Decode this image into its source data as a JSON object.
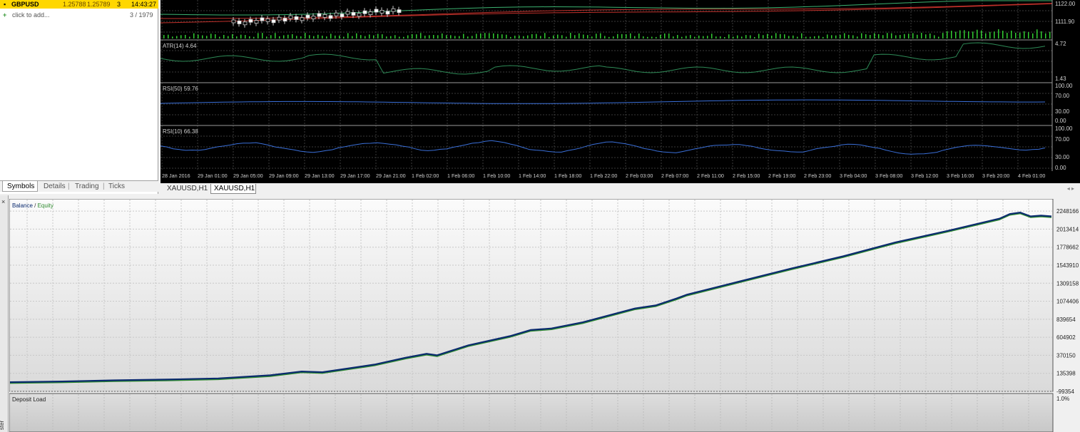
{
  "market_watch": {
    "row": {
      "symbol": "GBPUSD",
      "bid": "1.25788",
      "ask": "1.25789",
      "spread": "3",
      "time": "14:43:27"
    },
    "add_label": "click to add...",
    "count": "3 / 1979",
    "tabs": [
      "Symbols",
      "Details",
      "Trading",
      "Ticks"
    ],
    "active_tab": "Symbols"
  },
  "price_chart": {
    "price_axis": [
      "1122.00",
      "1111.90"
    ],
    "atr": {
      "label": "ATR(14) 4.64",
      "axis": [
        "4.72",
        "1.43"
      ]
    },
    "rsi50": {
      "label": "RSI(50) 59.76",
      "axis": [
        "100.00",
        "70.00",
        "30.00",
        "0.00"
      ]
    },
    "rsi10": {
      "label": "RSI(10) 66.38",
      "axis": [
        "100.00",
        "70.00",
        "30.00",
        "0.00"
      ]
    },
    "time_axis": [
      "28 Jan 2016",
      "29 Jan 01:00",
      "29 Jan 05:00",
      "29 Jan 09:00",
      "29 Jan 13:00",
      "29 Jan 17:00",
      "29 Jan 21:00",
      "1 Feb 02:00",
      "1 Feb 06:00",
      "1 Feb 10:00",
      "1 Feb 14:00",
      "1 Feb 18:00",
      "1 Feb 22:00",
      "2 Feb 03:00",
      "2 Feb 07:00",
      "2 Feb 11:00",
      "2 Feb 15:00",
      "2 Feb 19:00",
      "2 Feb 23:00",
      "3 Feb 04:00",
      "3 Feb 08:00",
      "3 Feb 12:00",
      "3 Feb 16:00",
      "3 Feb 20:00",
      "4 Feb 01:00"
    ],
    "tabs": [
      "XAUUSD,H1",
      "XAUUSD,H1"
    ],
    "active_tab_index": 1,
    "tab_arrows": "◂ ▸",
    "colors": {
      "background": "#000000",
      "grid": "#3a3a3a",
      "atr_line": "#2e8b57",
      "rsi_line": "#3a6fd8",
      "ma_red": "#c0302a",
      "ma_green": "#3cb371",
      "volume": "#32cd32"
    }
  },
  "tester": {
    "side_label": "ster",
    "close_label": "×",
    "balance_label": "Balance",
    "separator": " / ",
    "equity_label": "Equity",
    "y_axis": [
      "2248166",
      "2013414",
      "1778662",
      "1543910",
      "1309158",
      "1074406",
      "839654",
      "604902",
      "370150",
      "135398",
      "-99354"
    ],
    "deposit_load_label": "Deposit Load",
    "deposit_load_axis": "1.0%",
    "colors": {
      "balance": "#0a2a6e",
      "equity": "#2e8b2e"
    }
  },
  "chart_data": {
    "type": "line",
    "title": "",
    "xlabel": "",
    "ylabel": "",
    "ylim": [
      -99354,
      2370000
    ],
    "series": [
      {
        "name": "Balance",
        "x": [
          0,
          5,
          10,
          15,
          20,
          25,
          28,
          30,
          35,
          38,
          40,
          41,
          44,
          48,
          50,
          52,
          55,
          60,
          62,
          64,
          65,
          70,
          75,
          80,
          85,
          90,
          95,
          96,
          97,
          98,
          99,
          100
        ],
        "y": [
          20000,
          30000,
          45000,
          55000,
          70000,
          110000,
          160000,
          150000,
          250000,
          340000,
          390000,
          370000,
          500000,
          620000,
          700000,
          720000,
          800000,
          980000,
          1020000,
          1110000,
          1160000,
          1330000,
          1500000,
          1660000,
          1840000,
          1990000,
          2150000,
          2210000,
          2230000,
          2180000,
          2190000,
          2180000
        ]
      }
    ]
  }
}
